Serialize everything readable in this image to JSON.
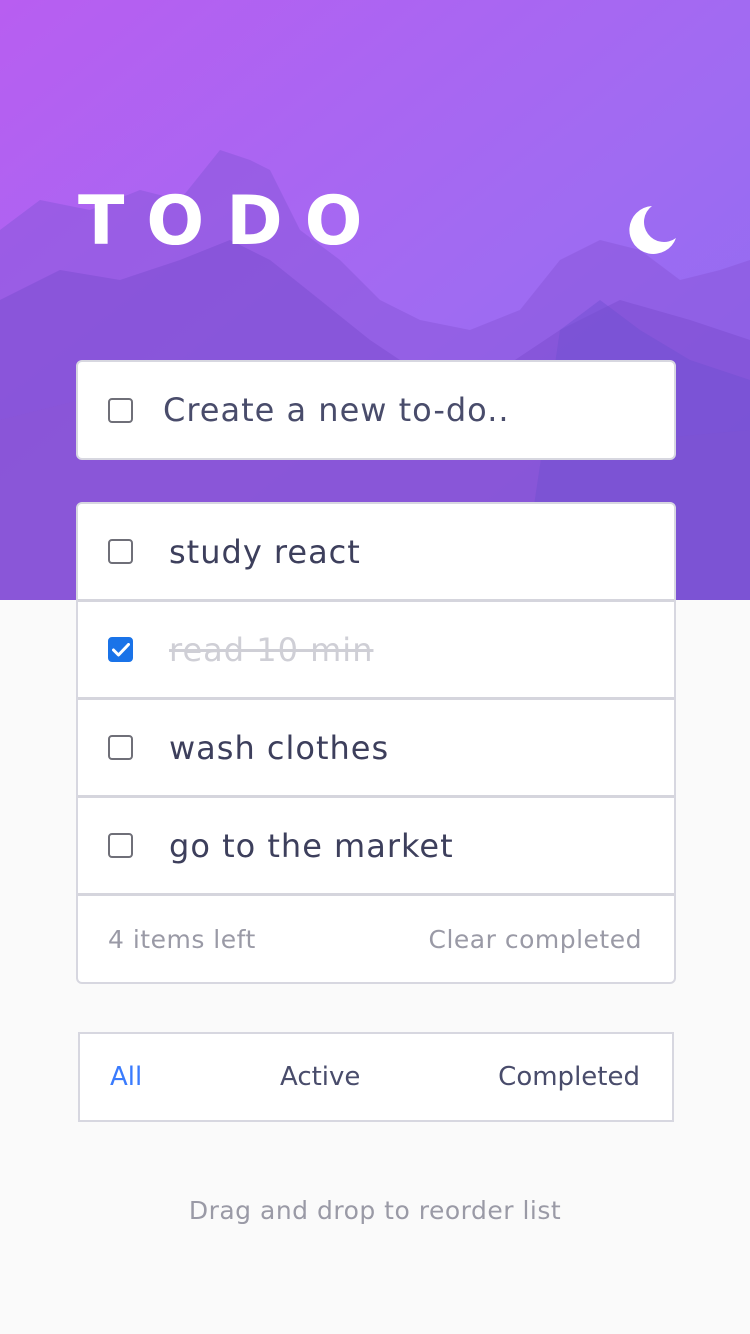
{
  "header": {
    "title": "TODO",
    "theme_icon": "moon-icon"
  },
  "new_todo": {
    "placeholder": "Create a new to-do.."
  },
  "todos": [
    {
      "label": "study react",
      "completed": false
    },
    {
      "label": "read 10 min",
      "completed": true
    },
    {
      "label": "wash clothes",
      "completed": false
    },
    {
      "label": "go to the market",
      "completed": false
    }
  ],
  "footer": {
    "items_left": "4 items left",
    "clear_label": "Clear completed"
  },
  "filters": {
    "all": "All",
    "active": "Active",
    "completed": "Completed",
    "selected": "All"
  },
  "hint": "Drag and drop to reorder list",
  "colors": {
    "accent": "#3a7bfd",
    "checkbox_checked": "#1a73e8",
    "text": "#494c6b",
    "muted": "#9a9aa6",
    "hero_gradient_start": "#b65ff0",
    "hero_gradient_end": "#7a63e8"
  }
}
